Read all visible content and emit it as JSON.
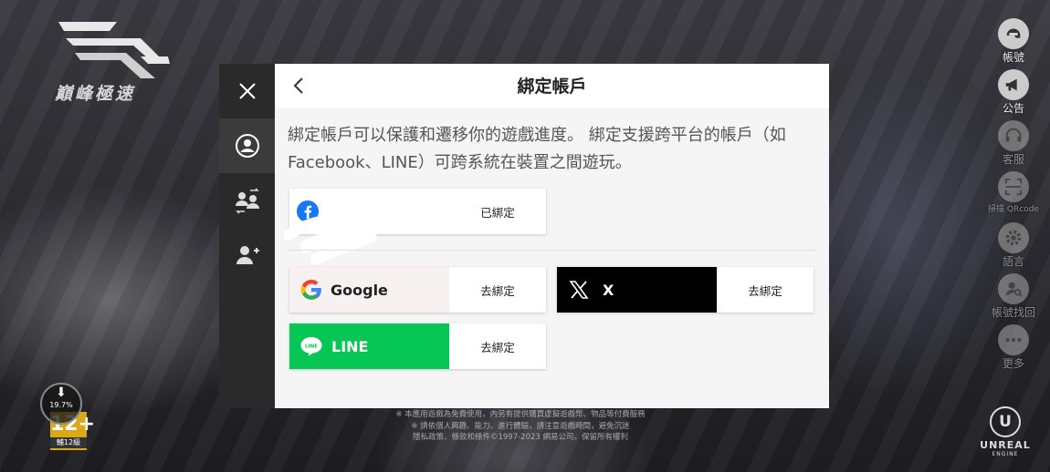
{
  "game": {
    "logo_text": "巔峰極速",
    "download_progress": "19.7%",
    "age_rating": "12+",
    "age_label": "輔12級",
    "footer_lines": [
      "※ 本應用遊戲為免費使用，內另有提供購買虛擬遊戲幣、物品等付費服務",
      "※ 請依個人興趣、能力、進行體驗，請注意遊戲時間，避免沉迷",
      "隱私政策、條款和條件©1997-2023 網易公司。保留所有權利"
    ]
  },
  "right_menu": [
    {
      "label": "帳號",
      "icon": "helmet-icon"
    },
    {
      "label": "公告",
      "icon": "megaphone-icon"
    },
    {
      "label": "客服",
      "icon": "headset-icon"
    },
    {
      "label": "掃描 QRcode",
      "icon": "qr-scan-icon"
    },
    {
      "label": "語言",
      "icon": "gear-icon"
    },
    {
      "label": "帳號找回",
      "icon": "account-search-icon"
    },
    {
      "label": "更多",
      "icon": "more-icon"
    }
  ],
  "engine": {
    "name": "UNREAL",
    "sub": "ENGINE"
  },
  "dialog": {
    "title": "綁定帳戶",
    "description": "綁定帳戶可以保護和遷移你的遊戲進度。 綁定支援跨平台的帳戶（如 Facebook、LINE）可跨系統在裝置之間遊玩。",
    "bound": {
      "platform_icon": "facebook-icon",
      "status": "已綁定"
    },
    "providers": [
      {
        "name": "Google",
        "action": "去綁定",
        "color": "#f7f1f1"
      },
      {
        "name": "X",
        "action": "去綁定",
        "color": "#000000"
      },
      {
        "name": "LINE",
        "action": "去綁定",
        "color": "#06c755"
      }
    ]
  },
  "sidebar": [
    "close-icon",
    "account-icon",
    "switch-account-icon",
    "add-account-icon"
  ]
}
